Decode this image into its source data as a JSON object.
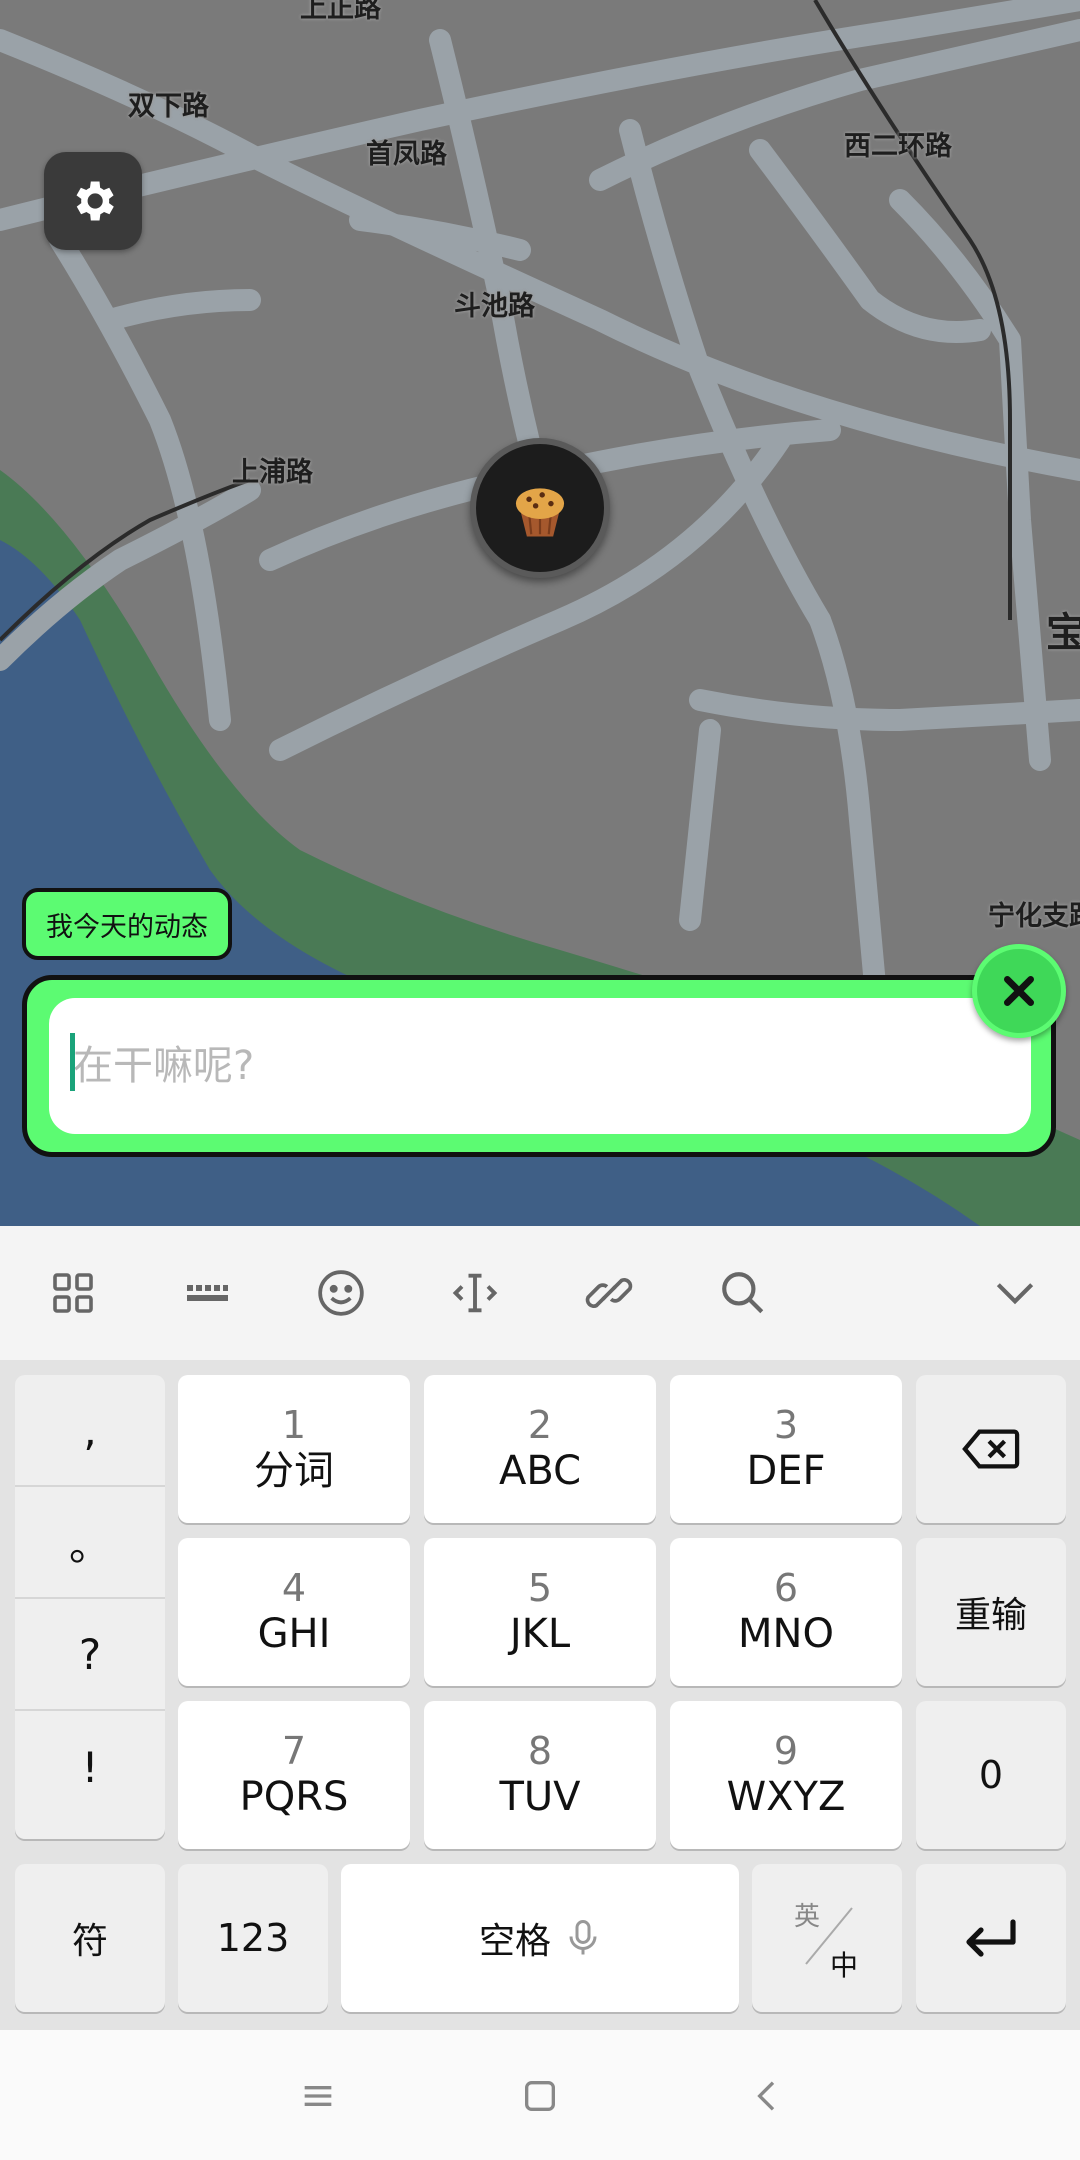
{
  "map": {
    "road_labels": [
      "双下路",
      "首凤路",
      "西二环路",
      "斗池路",
      "上浦路",
      "宁化支路",
      "宝",
      "上正路"
    ],
    "colors": {
      "background": "#7a7a7a",
      "road": "#9aa2a8",
      "water": "#3f5f86",
      "park": "#4a7a55"
    }
  },
  "settings_button": {
    "icon": "gear-icon"
  },
  "user_marker": {
    "icon": "muffin-icon"
  },
  "status": {
    "tag_label": "我今天的动态",
    "input_placeholder": "在干嘛呢?",
    "input_value": "",
    "accent_color": "#5cfb72"
  },
  "keyboard": {
    "toolbar_icons": [
      "grid-menu-icon",
      "keyboard-icon",
      "emoji-icon",
      "cursor-icon",
      "clip-icon",
      "search-icon",
      "collapse-icon"
    ],
    "punctuation": [
      ",",
      "。",
      "?",
      "!"
    ],
    "keys": [
      {
        "num": "1",
        "letters": "分词"
      },
      {
        "num": "2",
        "letters": "ABC"
      },
      {
        "num": "3",
        "letters": "DEF"
      },
      {
        "num": "4",
        "letters": "GHI"
      },
      {
        "num": "5",
        "letters": "JKL"
      },
      {
        "num": "6",
        "letters": "MNO"
      },
      {
        "num": "7",
        "letters": "PQRS"
      },
      {
        "num": "8",
        "letters": "TUV"
      },
      {
        "num": "9",
        "letters": "WXYZ"
      }
    ],
    "reinput_label": "重输",
    "zero_label": "0",
    "symbol_label": "符",
    "num_label": "123",
    "space_label": "空格",
    "lang_top": "英",
    "lang_bottom": "中"
  },
  "navbar": {
    "icons": [
      "menu-icon",
      "home-icon",
      "back-icon"
    ]
  }
}
